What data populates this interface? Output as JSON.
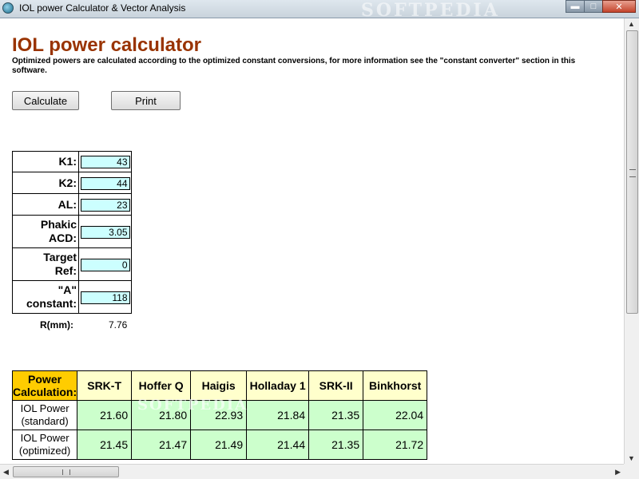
{
  "window": {
    "title": "IOL power Calculator & Vector Analysis",
    "watermark": "SOFTPEDIA",
    "minimize_glyph": "▬",
    "maximize_glyph": "□",
    "close_glyph": "✕"
  },
  "header": {
    "title": "IOL power calculator",
    "description": "Optimized powers are calculated according to the optimized constant conversions, for more information see the \"constant converter\" section in this software."
  },
  "toolbar": {
    "calculate_label": "Calculate",
    "print_label": "Print"
  },
  "inputs": [
    {
      "line1": "K1:",
      "line2": "",
      "value": "43"
    },
    {
      "line1": "K2:",
      "line2": "",
      "value": "44"
    },
    {
      "line1": "AL:",
      "line2": "",
      "value": "23"
    },
    {
      "line1": "Phakic",
      "line2": "ACD:",
      "value": "3.05"
    },
    {
      "line1": "Target",
      "line2": "Ref:",
      "value": "0"
    },
    {
      "line1": "\"A\"",
      "line2": "constant:",
      "value": "118"
    }
  ],
  "radius": {
    "label": "R(mm):",
    "value": "7.76"
  },
  "power_table": {
    "corner_line1": "Power",
    "corner_line2": "Calculation:",
    "columns": [
      "SRK-T",
      "Hoffer Q",
      "Haigis",
      "Holladay 1",
      "SRK-II",
      "Binkhorst"
    ],
    "rows": [
      {
        "line1": "IOL Power",
        "line2": "(standard)",
        "values": [
          "21.60",
          "21.80",
          "22.93",
          "21.84",
          "21.35",
          "22.04"
        ]
      },
      {
        "line1": "IOL Power",
        "line2": "(optimized)",
        "values": [
          "21.45",
          "21.47",
          "21.49",
          "21.44",
          "21.35",
          "21.72"
        ]
      }
    ],
    "watermark": "SOFTPEDIA"
  },
  "icons": {
    "app": "eye-app-icon",
    "scroll_up": "scroll-up-arrow-icon",
    "scroll_down": "scroll-down-arrow-icon",
    "scroll_left": "scroll-left-arrow-icon",
    "scroll_right": "scroll-right-arrow-icon"
  },
  "colors": {
    "title": "#993300",
    "input_bg": "#ccffff",
    "corner_bg": "#ffcc00",
    "header_bg": "#ffffcc",
    "cell_bg": "#ccffcc"
  }
}
